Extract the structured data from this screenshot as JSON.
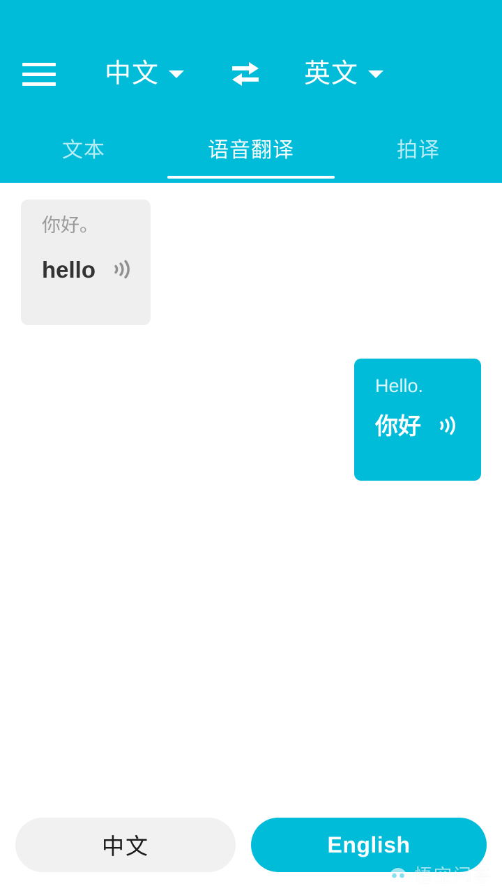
{
  "colors": {
    "brand_cyan": "#00BCD9",
    "bubble_incoming_bg": "#EFEFEF",
    "bubble_incoming_secondary_text": "#9A9A9A",
    "bubble_incoming_primary_text": "#333333",
    "mic_source_bg": "#F1F1F1",
    "page_bg": "#FFFFFF"
  },
  "header": {
    "menu_icon": "hamburger-menu-icon",
    "source_language": {
      "label": "中文",
      "caret_icon": "chevron-down-icon"
    },
    "swap_icon": "swap-horizontal-arrows-icon",
    "target_language": {
      "label": "英文",
      "caret_icon": "chevron-down-icon"
    },
    "tabs": [
      {
        "label": "文本",
        "active": false
      },
      {
        "label": "语音翻译",
        "active": true
      },
      {
        "label": "拍译",
        "active": false
      }
    ]
  },
  "conversation": {
    "messages": [
      {
        "side": "incoming",
        "secondary_text": "你好。",
        "primary_text": "hello",
        "speaker_icon": "sound-waves-icon"
      },
      {
        "side": "outgoing",
        "secondary_text": "Hello.",
        "primary_text": "你好",
        "speaker_icon": "sound-waves-icon"
      }
    ]
  },
  "mic_bar": {
    "source_button_label": "中文",
    "target_button_label": "English"
  },
  "watermark": {
    "text": "悟空问答",
    "logo_icon": "wukong-logo-icon"
  }
}
